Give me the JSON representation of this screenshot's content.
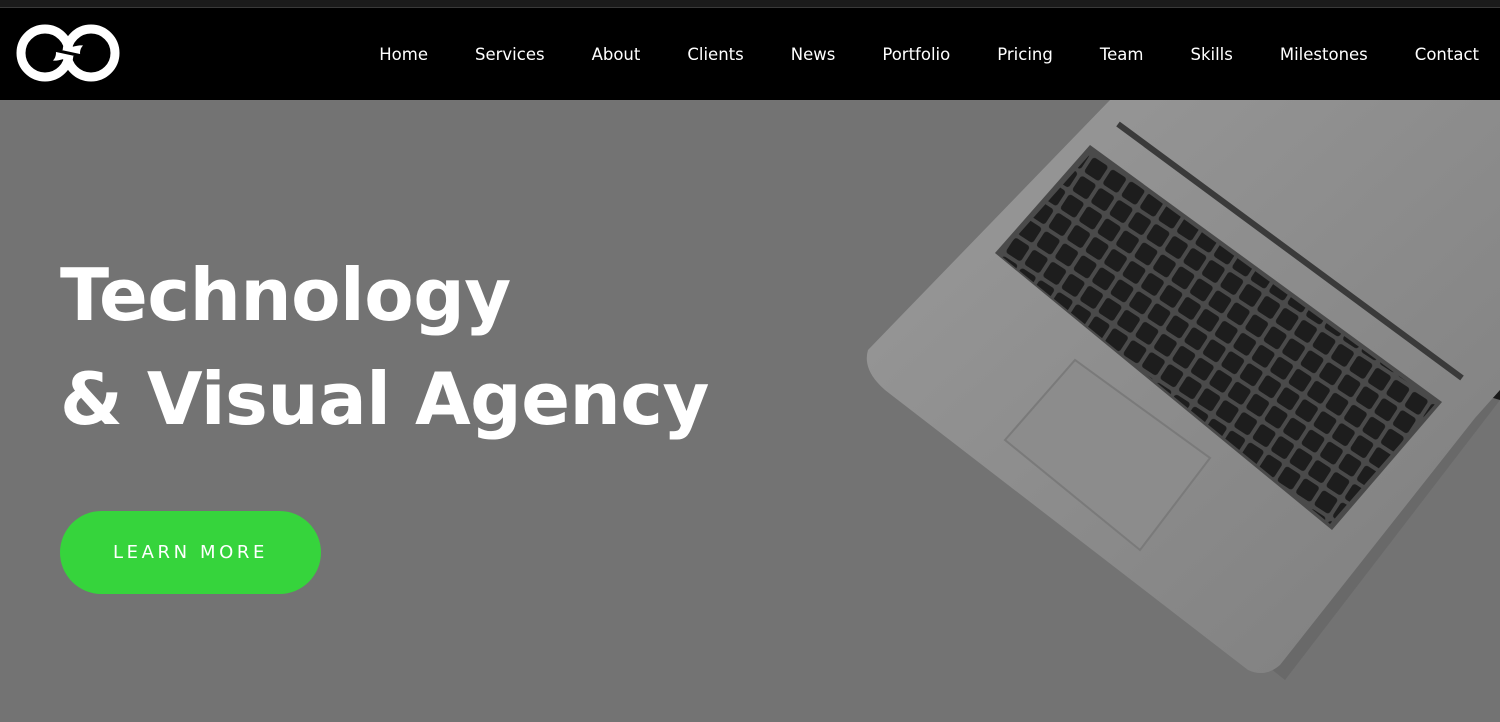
{
  "nav": {
    "items": [
      "Home",
      "Services",
      "About",
      "Clients",
      "News",
      "Portfolio",
      "Pricing",
      "Team",
      "Skills",
      "Milestones",
      "Contact"
    ]
  },
  "logo": {
    "icon": "infinity-logo-icon"
  },
  "hero": {
    "title_line1": "Technology",
    "title_line2": "& Visual Agency",
    "cta_label": "LEARN MORE",
    "image": "laptop-keyboard-image"
  },
  "colors": {
    "navbar_bg": "#000000",
    "hero_overlay": "#737373",
    "cta_green": "#36d43c",
    "text": "#ffffff"
  }
}
